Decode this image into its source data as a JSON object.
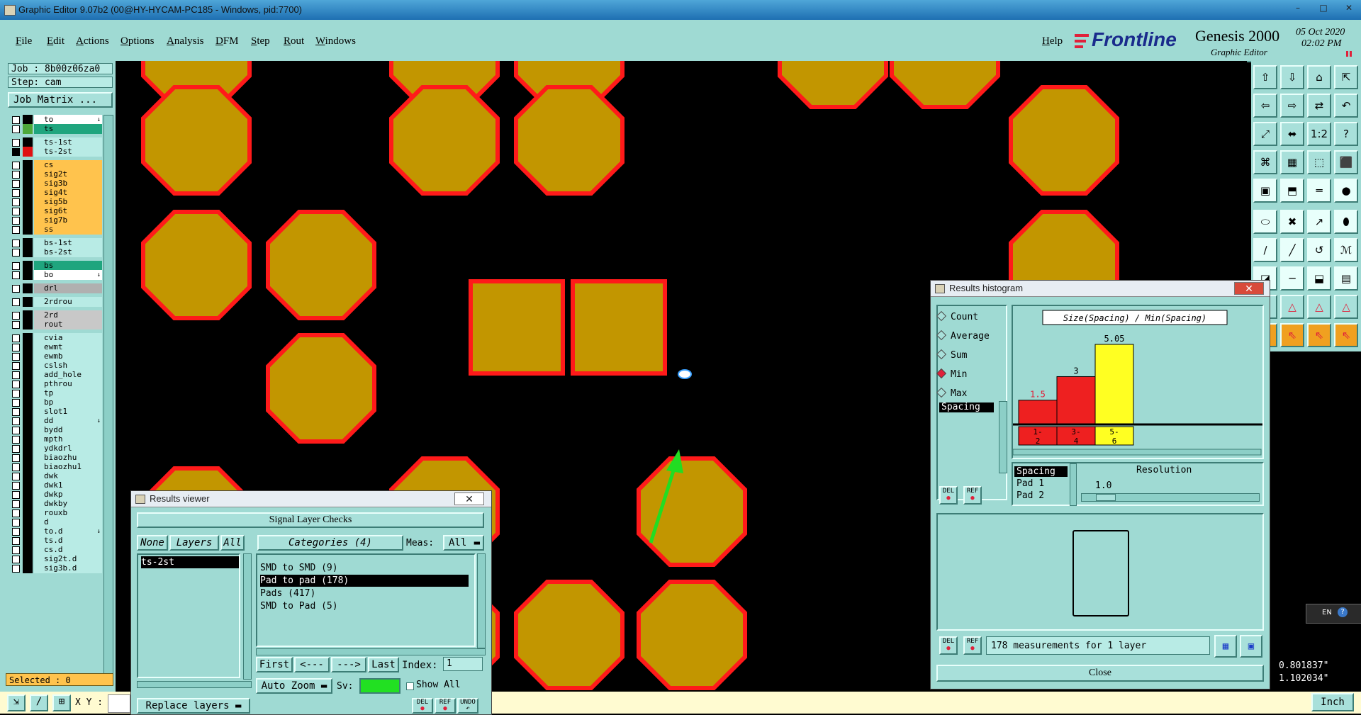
{
  "window": {
    "title": "Graphic Editor 9.07b2 (00@HY-HYCAM-PC185 - Windows, pid:7700)"
  },
  "menu": [
    "File",
    "Edit",
    "Actions",
    "Options",
    "Analysis",
    "DFM",
    "Step",
    "Rout",
    "Windows"
  ],
  "help_label": "Help",
  "brand": {
    "logo": "Frontline",
    "product": "Genesis 2000",
    "subtitle": "Graphic Editor",
    "date": "05 Oct 2020",
    "time": "02:02 PM"
  },
  "job": {
    "job_label": "Job : 8b00z06za0",
    "step_label": "Step: cam",
    "matrix_button": "Job Matrix ..."
  },
  "layers": [
    {
      "name": "to",
      "color": "#ffffff",
      "swatch": "#000000",
      "arrow": true
    },
    {
      "name": "ts",
      "color": "#1fa57e",
      "swatch": "#4da93a"
    },
    {
      "name": "ts-1st",
      "color": "#b8ebe5",
      "swatch": "#000000"
    },
    {
      "name": "ts-2st",
      "color": "#b8ebe5",
      "swatch": "#e01010",
      "selected": true
    },
    {
      "name": "cs",
      "color": "#ffc34d",
      "swatch": "#000000"
    },
    {
      "name": "sig2t",
      "color": "#ffc34d",
      "swatch": "#000000"
    },
    {
      "name": "sig3b",
      "color": "#ffc34d",
      "swatch": "#000000"
    },
    {
      "name": "sig4t",
      "color": "#ffc34d",
      "swatch": "#000000"
    },
    {
      "name": "sig5b",
      "color": "#ffc34d",
      "swatch": "#000000"
    },
    {
      "name": "sig6t",
      "color": "#ffc34d",
      "swatch": "#000000"
    },
    {
      "name": "sig7b",
      "color": "#ffc34d",
      "swatch": "#000000"
    },
    {
      "name": "ss",
      "color": "#ffc34d",
      "swatch": "#000000"
    },
    {
      "name": "bs-1st",
      "color": "#b8ebe5",
      "swatch": "#000000"
    },
    {
      "name": "bs-2st",
      "color": "#b8ebe5",
      "swatch": "#000000"
    },
    {
      "name": "bs",
      "color": "#1fa57e",
      "swatch": "#000000"
    },
    {
      "name": "bo",
      "color": "#ffffff",
      "swatch": "#000000",
      "arrow": true
    },
    {
      "name": "drl",
      "color": "#b0b0b0",
      "swatch": "#000000"
    },
    {
      "name": "2rdrou",
      "color": "#b8ebe5",
      "swatch": "#000000"
    },
    {
      "name": "2rd",
      "color": "#c8c8c8",
      "swatch": "#000000"
    },
    {
      "name": "rout",
      "color": "#c8c8c8",
      "swatch": "#000000"
    },
    {
      "name": "cvia",
      "color": "#b8ebe5",
      "swatch": "#000000"
    },
    {
      "name": "ewmt",
      "color": "#b8ebe5",
      "swatch": "#000000"
    },
    {
      "name": "ewmb",
      "color": "#b8ebe5",
      "swatch": "#000000"
    },
    {
      "name": "cslsh",
      "color": "#b8ebe5",
      "swatch": "#000000"
    },
    {
      "name": "add_hole",
      "color": "#b8ebe5",
      "swatch": "#000000"
    },
    {
      "name": "pthrou",
      "color": "#b8ebe5",
      "swatch": "#000000"
    },
    {
      "name": "tp",
      "color": "#b8ebe5",
      "swatch": "#000000"
    },
    {
      "name": "bp",
      "color": "#b8ebe5",
      "swatch": "#000000"
    },
    {
      "name": "slot1",
      "color": "#b8ebe5",
      "swatch": "#000000"
    },
    {
      "name": "dd",
      "color": "#b8ebe5",
      "swatch": "#000000",
      "arrow": true
    },
    {
      "name": "bydd",
      "color": "#b8ebe5",
      "swatch": "#000000"
    },
    {
      "name": "mpth",
      "color": "#b8ebe5",
      "swatch": "#000000"
    },
    {
      "name": "ydkdrl",
      "color": "#b8ebe5",
      "swatch": "#000000"
    },
    {
      "name": "biaozhu",
      "color": "#b8ebe5",
      "swatch": "#000000"
    },
    {
      "name": "biaozhu1",
      "color": "#b8ebe5",
      "swatch": "#000000"
    },
    {
      "name": "dwk",
      "color": "#b8ebe5",
      "swatch": "#000000"
    },
    {
      "name": "dwk1",
      "color": "#b8ebe5",
      "swatch": "#000000"
    },
    {
      "name": "dwkp",
      "color": "#b8ebe5",
      "swatch": "#000000"
    },
    {
      "name": "dwkby",
      "color": "#b8ebe5",
      "swatch": "#000000"
    },
    {
      "name": "rouxb",
      "color": "#b8ebe5",
      "swatch": "#000000"
    },
    {
      "name": "d",
      "color": "#b8ebe5",
      "swatch": "#000000"
    },
    {
      "name": "to.d",
      "color": "#b8ebe5",
      "swatch": "#000000",
      "arrow": true
    },
    {
      "name": "ts.d",
      "color": "#b8ebe5",
      "swatch": "#000000"
    },
    {
      "name": "cs.d",
      "color": "#b8ebe5",
      "swatch": "#000000"
    },
    {
      "name": "sig2t.d",
      "color": "#b8ebe5",
      "swatch": "#000000"
    },
    {
      "name": "sig3b.d",
      "color": "#b8ebe5",
      "swatch": "#000000"
    }
  ],
  "selected_label": "Selected : 0",
  "status": {
    "xy_label": "X Y :",
    "coord_x": "0.801837\"",
    "coord_y": "1.102034\"",
    "units": "Inch",
    "lang": "EN"
  },
  "results_viewer": {
    "title": "Results viewer",
    "header": "Signal Layer Checks",
    "none_btn": "None",
    "layers_btn": "Layers",
    "all_btn": "All",
    "categories_label": "Categories (4)",
    "meas_label": "Meas:",
    "meas_value": "All",
    "layer_items": [
      "ts-2st"
    ],
    "categories": [
      "SMD to SMD (9)",
      "Pad to pad (178)",
      "Pads (417)",
      "SMD to Pad (5)"
    ],
    "selected_category": 1,
    "first_btn": "First",
    "prev_btn": "<---",
    "next_btn": "--->",
    "last_btn": "Last",
    "index_label": "Index:",
    "index_value": "1",
    "autozoom_label": "Auto Zoom",
    "sv_label": "Sv:",
    "showall_label": "Show All",
    "replace_label": "Replace layers",
    "del_label": "DEL",
    "ref_label": "REF",
    "undo_label": "UNDO"
  },
  "histogram": {
    "title": "Results histogram",
    "modes": [
      "Count",
      "Average",
      "Sum",
      "Min",
      "Max"
    ],
    "selected_mode": "Min",
    "list_item": "Spacing",
    "chart_title": "Size(Spacing) / Min(Spacing)",
    "resolution_label": "Resolution",
    "resolution_value": "1.0",
    "legend": [
      "Spacing",
      "Pad 1",
      "Pad 2"
    ],
    "measurements": "178 measurements for 1 layer",
    "close_label": "Close",
    "del_label": "DEL",
    "ref_label": "REF"
  },
  "chart_data": {
    "type": "bar",
    "title": "Size(Spacing) / Min(Spacing)",
    "categories": [
      "1-2",
      "3-4",
      "5-6"
    ],
    "values": [
      1.5,
      3,
      5.05
    ],
    "value_labels": [
      "1.5",
      "3",
      "5.05"
    ],
    "colors": [
      "#ee2020",
      "#ee2020",
      "#ffff22"
    ],
    "ylim": [
      0,
      5.05
    ]
  },
  "colors": {
    "panel": "#9fdad3",
    "pad_fill": "#c29600",
    "pad_outline": "#ff1a1a",
    "arrow": "#22dd22"
  }
}
